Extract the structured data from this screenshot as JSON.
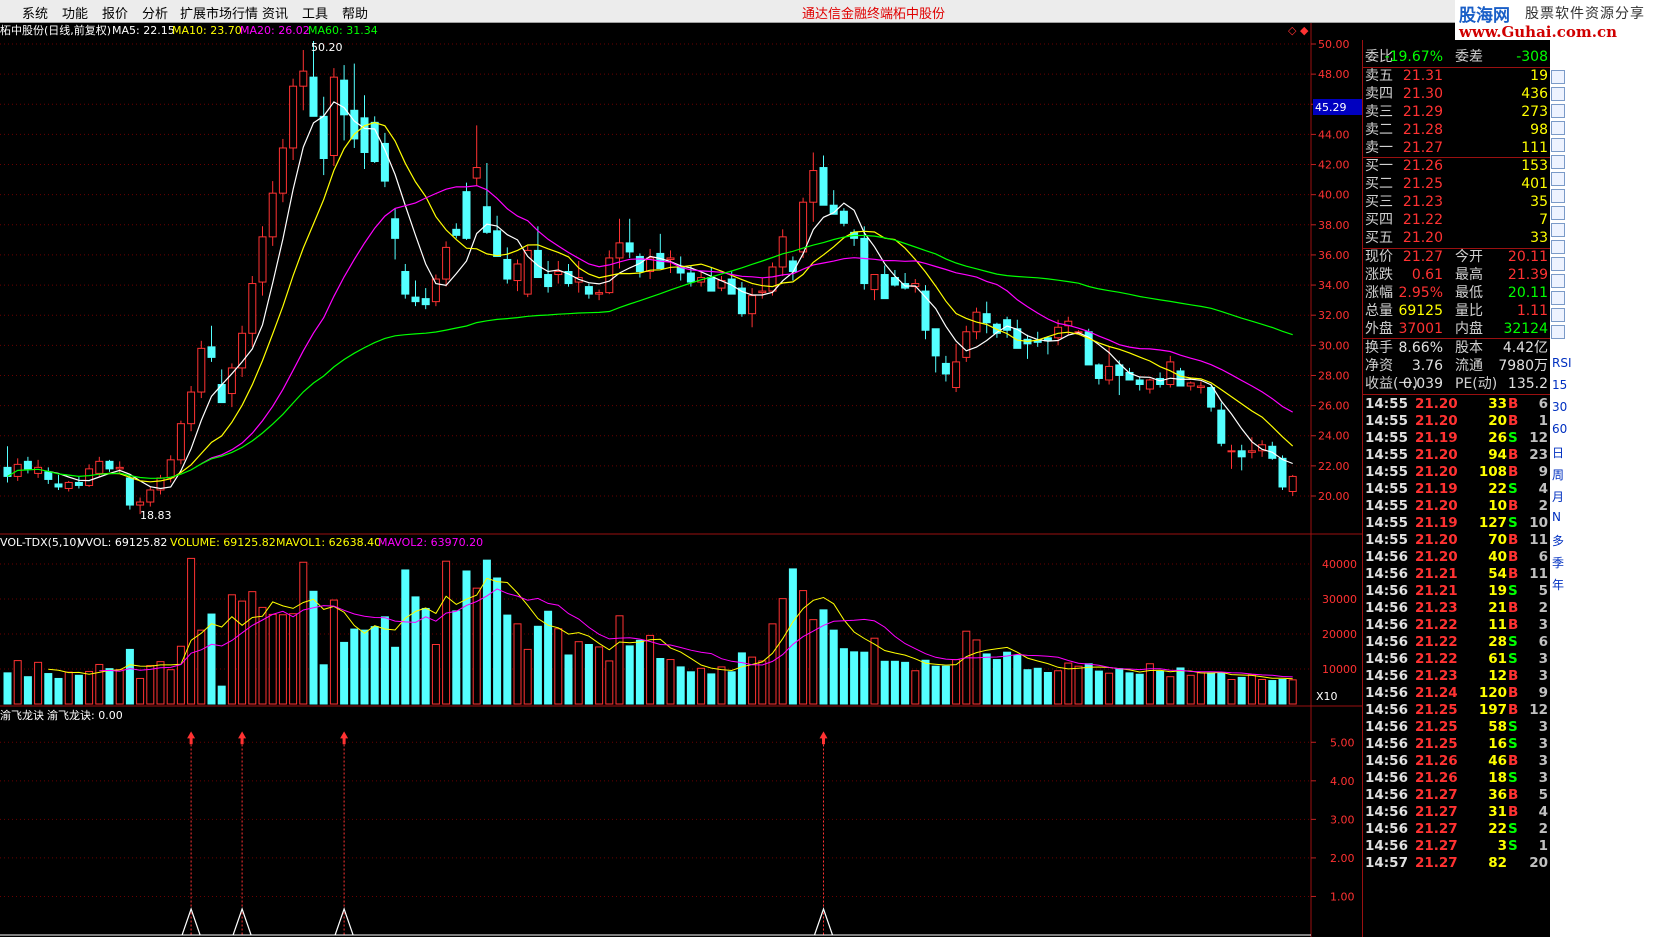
{
  "menu": {
    "items": [
      "系统",
      "功能",
      "报价",
      "分析",
      "扩展市场行情",
      "资讯",
      "工具",
      "帮助"
    ],
    "center": [
      "通达信金融终端",
      "柘中股份"
    ]
  },
  "logo": {
    "title": "股海网",
    "subtitle": "股票软件资源分享",
    "url": "www.Guhai.com.cn"
  },
  "main_chart": {
    "header": {
      "name": "柘中股份(日线,前复权)",
      "ma5": "MA5: 22.15",
      "ma10": "MA10: 23.70",
      "ma20": "MA20: 26.02",
      "ma60": "MA60: 31.34"
    },
    "price_axis": [
      "50.00",
      "48.00",
      "46.00",
      "44.00",
      "42.00",
      "40.00",
      "38.00",
      "36.00",
      "34.00",
      "32.00",
      "30.00",
      "28.00",
      "26.00",
      "24.00",
      "22.00",
      "20.00"
    ],
    "current_tag": "45.29",
    "high_label": "50.20",
    "low_label": "18.83",
    "colors": {
      "up": "#ff3232",
      "down": "#54ffff",
      "ma5": "#ffffff",
      "ma10": "#ffff00",
      "ma20": "#ff00ff",
      "ma60": "#00ff00"
    }
  },
  "vol_chart": {
    "header": {
      "name": "VOL-TDX(5,10)",
      "vvol": "VVOL: 69125.82",
      "volume": "VOLUME: 69125.82",
      "mavol1": "MAVOL1: 62638.40",
      "mavol2": "MAVOL2: 63970.20"
    },
    "axis": [
      "40000",
      "30000",
      "20000",
      "10000"
    ],
    "unit": "X10"
  },
  "ind_chart": {
    "header": {
      "name": "渝飞龙诀",
      "value": "渝飞龙诀: 0.00"
    },
    "axis": [
      "5.00",
      "4.00",
      "3.00",
      "2.00",
      "1.00"
    ]
  },
  "chart_data": {
    "type": "candlestick",
    "title": "柘中股份(日线,前复权)",
    "ylim": [
      19,
      51
    ],
    "candles": [
      [
        21.9,
        23.3,
        20.9,
        21.3
      ],
      [
        21.3,
        22.5,
        21,
        22.1
      ],
      [
        22.3,
        22.6,
        21.5,
        21.8
      ],
      [
        21.5,
        22.4,
        21.2,
        21.9
      ],
      [
        21.6,
        21.9,
        20.8,
        21.1
      ],
      [
        20.8,
        21.4,
        20.4,
        20.6
      ],
      [
        20.5,
        21,
        20.3,
        20.9
      ],
      [
        20.9,
        21.3,
        20.5,
        20.7
      ],
      [
        20.7,
        22.1,
        20.6,
        21.8
      ],
      [
        21.5,
        22.6,
        21.3,
        22.3
      ],
      [
        22.3,
        22.4,
        21.6,
        21.8
      ],
      [
        21.8,
        22.3,
        21.5,
        21.9
      ],
      [
        21.2,
        21.4,
        19.1,
        19.4
      ],
      [
        19.4,
        19.9,
        18.8,
        19.6
      ],
      [
        19.6,
        20.6,
        19.3,
        20.4
      ],
      [
        20.4,
        21.4,
        20.1,
        21.2
      ],
      [
        21.2,
        22.7,
        20.9,
        22.4
      ],
      [
        22.4,
        25,
        22.1,
        24.8
      ],
      [
        24.8,
        27.3,
        24.3,
        26.9
      ],
      [
        26.9,
        30.3,
        26.5,
        29.8
      ],
      [
        29.9,
        31.3,
        28.9,
        29.2
      ],
      [
        27.4,
        28.4,
        26.8,
        26.2
      ],
      [
        26.8,
        28.8,
        25.9,
        28.5
      ],
      [
        28.5,
        31.3,
        27.9,
        30.8
      ],
      [
        30.8,
        34.6,
        29.9,
        34.1
      ],
      [
        34.2,
        37.9,
        33.3,
        37.2
      ],
      [
        37.2,
        40.9,
        36.6,
        40.1
      ],
      [
        40.1,
        43.7,
        39.5,
        43.1
      ],
      [
        43.1,
        47.7,
        42.3,
        47.2
      ],
      [
        47.2,
        49.6,
        45.6,
        48.2
      ],
      [
        47.8,
        50.2,
        45.9,
        45.2
      ],
      [
        45.2,
        46.5,
        41.3,
        42.4
      ],
      [
        42.6,
        48.4,
        41.9,
        47.8
      ],
      [
        47.6,
        48.6,
        43.6,
        45.3
      ],
      [
        45.6,
        48.7,
        43.1,
        43.7
      ],
      [
        45.1,
        46.6,
        41.7,
        42.8
      ],
      [
        44.8,
        45.2,
        42.1,
        42.2
      ],
      [
        43.4,
        44.1,
        40.5,
        40.9
      ],
      [
        38.4,
        39.1,
        35.7,
        37.1
      ],
      [
        34.9,
        35.4,
        33.1,
        33.4
      ],
      [
        33.2,
        34.3,
        32.6,
        32.9
      ],
      [
        33.1,
        33.8,
        32.4,
        32.7
      ],
      [
        32.9,
        34.7,
        32.6,
        34.4
      ],
      [
        34.4,
        36.9,
        33.9,
        36.5
      ],
      [
        37.7,
        38.1,
        37.1,
        37.3
      ],
      [
        40.2,
        40.8,
        37,
        37.1
      ],
      [
        41.1,
        44.6,
        40.6,
        41.8
      ],
      [
        39.2,
        42.1,
        37.4,
        37.5
      ],
      [
        37.6,
        38.6,
        35.9,
        35.9
      ],
      [
        35.7,
        36.5,
        34.1,
        34.4
      ],
      [
        34.3,
        35.7,
        33.6,
        35.4
      ],
      [
        33.4,
        36.6,
        33.2,
        36.3
      ],
      [
        36.3,
        37.9,
        35.1,
        34.5
      ],
      [
        34.7,
        35.6,
        33.5,
        33.9
      ],
      [
        34.7,
        35.6,
        34.1,
        34.9
      ],
      [
        34.9,
        35.4,
        33.9,
        34.1
      ],
      [
        34.2,
        35.6,
        33.5,
        34.5
      ],
      [
        33.9,
        34.1,
        33.1,
        33.4
      ],
      [
        33.4,
        33.7,
        33,
        33.5
      ],
      [
        33.5,
        36.3,
        33.4,
        35.8
      ],
      [
        35.8,
        38.4,
        35.1,
        36.8
      ],
      [
        36.8,
        38.4,
        35.8,
        36.2
      ],
      [
        35.9,
        36.1,
        34.5,
        34.9
      ],
      [
        34.9,
        36.4,
        34.4,
        35.8
      ],
      [
        36.1,
        37.4,
        35.3,
        35.1
      ],
      [
        35.7,
        36.3,
        34.8,
        35.8
      ],
      [
        35.2,
        35.9,
        34.3,
        34.8
      ],
      [
        34.8,
        35.3,
        33.9,
        34.2
      ],
      [
        34.2,
        34.9,
        33.9,
        34.5
      ],
      [
        34.5,
        35.2,
        33.7,
        33.6
      ],
      [
        33.8,
        34.6,
        33.6,
        34.3
      ],
      [
        34.4,
        34.9,
        33.6,
        33.4
      ],
      [
        33.8,
        34.2,
        31.9,
        32.1
      ],
      [
        32.1,
        33.8,
        31.2,
        33.3
      ],
      [
        33.5,
        34.5,
        33.1,
        33.6
      ],
      [
        33.6,
        35.5,
        33.3,
        35.2
      ],
      [
        35.2,
        37.7,
        34.6,
        37.2
      ],
      [
        35.6,
        35.9,
        34.3,
        34.9
      ],
      [
        36.2,
        39.8,
        35.8,
        39.5
      ],
      [
        39.5,
        42.8,
        38.2,
        41.6
      ],
      [
        41.8,
        42.6,
        39.9,
        39.3
      ],
      [
        39.3,
        40.3,
        38.7,
        38.7
      ],
      [
        38.9,
        39.1,
        37.9,
        38.1
      ],
      [
        37.5,
        37.7,
        36.6,
        37.1
      ],
      [
        37.1,
        37.9,
        33.7,
        34.1
      ],
      [
        33.7,
        34.6,
        33,
        34.7
      ],
      [
        34.7,
        35.3,
        33.2,
        33.1
      ],
      [
        34.5,
        35,
        33.9,
        34
      ],
      [
        34.1,
        34.8,
        33.7,
        33.8
      ],
      [
        33.9,
        34.4,
        33.5,
        34.1
      ],
      [
        33.6,
        34,
        30.4,
        31
      ],
      [
        31.1,
        31.1,
        28.2,
        29.3
      ],
      [
        28.8,
        29.3,
        27.6,
        28.1
      ],
      [
        27.2,
        30.1,
        26.9,
        28.9
      ],
      [
        29.2,
        31.3,
        28.9,
        30.9
      ],
      [
        30.9,
        32.5,
        30.4,
        32.2
      ],
      [
        32.1,
        32.9,
        30.8,
        31.5
      ],
      [
        31.4,
        31.5,
        30.5,
        30.8
      ],
      [
        31.7,
        31.9,
        30.5,
        31
      ],
      [
        31.1,
        31.7,
        30.2,
        29.8
      ],
      [
        30.4,
        30.7,
        29.1,
        30.1
      ],
      [
        30.3,
        30.9,
        29.9,
        30.2
      ],
      [
        30.5,
        30.6,
        29.4,
        30.3
      ],
      [
        30.5,
        31.7,
        30,
        31.2
      ],
      [
        31.3,
        31.9,
        30.7,
        31.6
      ],
      [
        30.9,
        31,
        30.8,
        30.9
      ],
      [
        30.9,
        31.1,
        28.9,
        28.7
      ],
      [
        28.7,
        28.8,
        27.4,
        27.8
      ],
      [
        27.7,
        29.9,
        27.4,
        28.6
      ],
      [
        28.7,
        29,
        26.7,
        28
      ],
      [
        28.2,
        28.5,
        27.8,
        27.7
      ],
      [
        27.7,
        27.9,
        27,
        27.4
      ],
      [
        27.1,
        27.8,
        26.8,
        27.7
      ],
      [
        27.8,
        28.2,
        27.2,
        27.4
      ],
      [
        27.4,
        29.3,
        27.2,
        28.9
      ],
      [
        28.3,
        28.5,
        27.5,
        27.3
      ],
      [
        27.3,
        27.6,
        27,
        27.5
      ],
      [
        27.2,
        27.6,
        26.8,
        27.3
      ],
      [
        27.2,
        27.4,
        25.6,
        25.9
      ],
      [
        25.7,
        26.2,
        23.3,
        23.5
      ],
      [
        23,
        23.4,
        21.8,
        23
      ],
      [
        23,
        23.4,
        21.7,
        22.6
      ],
      [
        22.9,
        23.9,
        22.5,
        23
      ],
      [
        23,
        23.7,
        22.6,
        23.4
      ],
      [
        23.3,
        23.6,
        22.4,
        22.5
      ],
      [
        22.5,
        22.7,
        20.4,
        20.6
      ],
      [
        20.3,
        21.4,
        20,
        21.3
      ]
    ],
    "volume": [
      8900,
      12400,
      7800,
      11900,
      8700,
      7300,
      9100,
      8200,
      9300,
      11300,
      10100,
      9800,
      15600,
      7300,
      11000,
      12100,
      9800,
      16500,
      41600,
      21100,
      25700,
      5100,
      31200,
      29400,
      32100,
      27600,
      25600,
      25500,
      25800,
      40500,
      32200,
      11200,
      29700,
      17600,
      21400,
      21100,
      22100,
      24900,
      16200,
      38300,
      30600,
      27300,
      17000,
      40800,
      26600,
      38000,
      33100,
      41100,
      36000,
      25400,
      22900,
      15600,
      22200,
      26500,
      21500,
      14000,
      17800,
      17000,
      16300,
      12300,
      25200,
      16600,
      18200,
      19600,
      13000,
      12700,
      10600,
      9200,
      10200,
      8600,
      10600,
      9200,
      14600,
      13400,
      12300,
      22900,
      30100,
      38600,
      32400,
      24100,
      26900,
      21100,
      15800,
      14900,
      14800,
      18800,
      12200,
      12200,
      11900,
      9500,
      12500,
      10800,
      10800,
      12700,
      20800,
      18300,
      14300,
      12700,
      14800,
      13900,
      9800,
      10200,
      9000,
      9500,
      11700,
      10800,
      11500,
      9400,
      8800,
      10100,
      8900,
      8500,
      11500,
      9300,
      7800,
      10300,
      8200,
      8900,
      8900,
      9000,
      7000,
      7600,
      8400,
      7000,
      6700,
      7000,
      6900
    ],
    "signal_bars": [
      18,
      23,
      33,
      80
    ]
  },
  "quote": {
    "weibi_label": "委比",
    "weibi": "-19.67%",
    "weicha_label": "委差",
    "weicha": "-308",
    "asks": [
      {
        "label": "卖五",
        "price": "21.31",
        "vol": "19"
      },
      {
        "label": "卖四",
        "price": "21.30",
        "vol": "436"
      },
      {
        "label": "卖三",
        "price": "21.29",
        "vol": "273"
      },
      {
        "label": "卖二",
        "price": "21.28",
        "vol": "98"
      },
      {
        "label": "卖一",
        "price": "21.27",
        "vol": "111"
      }
    ],
    "bids": [
      {
        "label": "买一",
        "price": "21.26",
        "vol": "153"
      },
      {
        "label": "买二",
        "price": "21.25",
        "vol": "401"
      },
      {
        "label": "买三",
        "price": "21.23",
        "vol": "35"
      },
      {
        "label": "买四",
        "price": "21.22",
        "vol": "7"
      },
      {
        "label": "买五",
        "price": "21.20",
        "vol": "33"
      }
    ],
    "stats": [
      {
        "l1": "现价",
        "v1": "21.27",
        "l2": "今开",
        "v2": "20.11"
      },
      {
        "l1": "涨跌",
        "v1": "0.61",
        "l2": "最高",
        "v2": "21.39"
      },
      {
        "l1": "涨幅",
        "v1": "2.95%",
        "l2": "最低",
        "v2": "20.11"
      },
      {
        "l1": "总量",
        "v1": "69125",
        "l2": "量比",
        "v2": "1.11"
      },
      {
        "l1": "外盘",
        "v1": "37001",
        "l2": "内盘",
        "v2": "32124"
      }
    ],
    "fund": [
      {
        "l1": "换手",
        "v1": "8.66%",
        "l2": "股本",
        "v2": "4.42亿"
      },
      {
        "l1": "净资",
        "v1": "3.76",
        "l2": "流通",
        "v2": "7980万"
      },
      {
        "l1": "收益(一)",
        "v1": "0.039",
        "l2": "PE(动)",
        "v2": "135.2"
      }
    ]
  },
  "ticks": [
    {
      "t": "14:55",
      "p": "21.20",
      "v": "33",
      "bs": "B",
      "n": "6"
    },
    {
      "t": "14:55",
      "p": "21.20",
      "v": "20",
      "bs": "B",
      "n": "1"
    },
    {
      "t": "14:55",
      "p": "21.19",
      "v": "26",
      "bs": "S",
      "n": "12"
    },
    {
      "t": "14:55",
      "p": "21.20",
      "v": "94",
      "bs": "B",
      "n": "23"
    },
    {
      "t": "14:55",
      "p": "21.20",
      "v": "108",
      "bs": "B",
      "n": "9"
    },
    {
      "t": "14:55",
      "p": "21.19",
      "v": "22",
      "bs": "S",
      "n": "4"
    },
    {
      "t": "14:55",
      "p": "21.20",
      "v": "10",
      "bs": "B",
      "n": "2"
    },
    {
      "t": "14:55",
      "p": "21.19",
      "v": "127",
      "bs": "S",
      "n": "10"
    },
    {
      "t": "14:55",
      "p": "21.20",
      "v": "70",
      "bs": "B",
      "n": "11"
    },
    {
      "t": "14:56",
      "p": "21.20",
      "v": "40",
      "bs": "B",
      "n": "6"
    },
    {
      "t": "14:56",
      "p": "21.21",
      "v": "54",
      "bs": "B",
      "n": "11"
    },
    {
      "t": "14:56",
      "p": "21.21",
      "v": "19",
      "bs": "S",
      "n": "5"
    },
    {
      "t": "14:56",
      "p": "21.23",
      "v": "21",
      "bs": "B",
      "n": "2"
    },
    {
      "t": "14:56",
      "p": "21.22",
      "v": "11",
      "bs": "B",
      "n": "3"
    },
    {
      "t": "14:56",
      "p": "21.22",
      "v": "28",
      "bs": "S",
      "n": "6"
    },
    {
      "t": "14:56",
      "p": "21.22",
      "v": "61",
      "bs": "S",
      "n": "3"
    },
    {
      "t": "14:56",
      "p": "21.23",
      "v": "12",
      "bs": "B",
      "n": "3"
    },
    {
      "t": "14:56",
      "p": "21.24",
      "v": "120",
      "bs": "B",
      "n": "9"
    },
    {
      "t": "14:56",
      "p": "21.25",
      "v": "197",
      "bs": "B",
      "n": "12"
    },
    {
      "t": "14:56",
      "p": "21.25",
      "v": "58",
      "bs": "S",
      "n": "3"
    },
    {
      "t": "14:56",
      "p": "21.25",
      "v": "16",
      "bs": "S",
      "n": "3"
    },
    {
      "t": "14:56",
      "p": "21.26",
      "v": "46",
      "bs": "B",
      "n": "3"
    },
    {
      "t": "14:56",
      "p": "21.26",
      "v": "18",
      "bs": "S",
      "n": "3"
    },
    {
      "t": "14:56",
      "p": "21.27",
      "v": "36",
      "bs": "B",
      "n": "5"
    },
    {
      "t": "14:56",
      "p": "21.27",
      "v": "31",
      "bs": "B",
      "n": "4"
    },
    {
      "t": "14:56",
      "p": "21.27",
      "v": "22",
      "bs": "S",
      "n": "2"
    },
    {
      "t": "14:56",
      "p": "21.27",
      "v": "3",
      "bs": "S",
      "n": "1"
    },
    {
      "t": "14:57",
      "p": "21.27",
      "v": "82",
      "bs": "",
      "n": "20"
    }
  ],
  "sidebar": {
    "labels": [
      "RSI",
      "15",
      "30",
      "60",
      "日",
      "周",
      "月",
      "N",
      "多",
      "季",
      "年"
    ]
  }
}
